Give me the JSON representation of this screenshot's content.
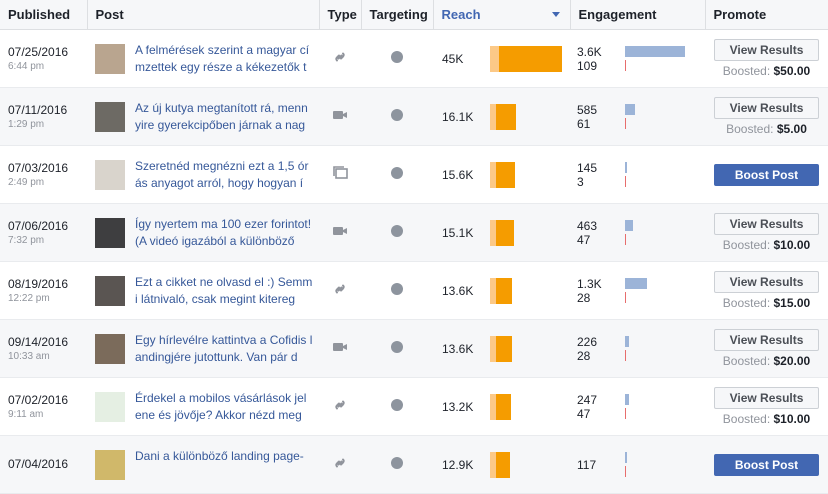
{
  "headers": {
    "published": "Published",
    "post": "Post",
    "type": "Type",
    "targeting": "Targeting",
    "reach": "Reach",
    "engagement": "Engagement",
    "promote": "Promote"
  },
  "rows": [
    {
      "date": "07/25/2016",
      "time": "6:44 pm",
      "text": "A felmérések szerint a magyar címzettek egy része a kékezetők többsége nem tudja",
      "type": "link-icon",
      "reach": "45K",
      "reach_fraction": 1.0,
      "eng_top": "3.6K",
      "eng_bottom": "109",
      "eng_fraction": 1.0,
      "promote_label": "View Results",
      "boosted_label": "Boosted:",
      "boosted_amount": "$50.00"
    },
    {
      "date": "07/11/2016",
      "time": "1:29 pm",
      "text": "Az új kutya megtanított rá, mennyire gyerekcipőben járnak a nag",
      "type": "video-icon",
      "reach": "16.1K",
      "reach_fraction": 0.36,
      "eng_top": "585",
      "eng_bottom": "61",
      "eng_fraction": 0.16,
      "promote_label": "View Results",
      "boosted_label": "Boosted:",
      "boosted_amount": "$5.00"
    },
    {
      "date": "07/03/2016",
      "time": "2:49 pm",
      "text": "Szeretnéd megnézni ezt a 1,5 órás anyagot arról, hogy hogyan í",
      "type": "album-icon",
      "reach": "15.6K",
      "reach_fraction": 0.35,
      "eng_top": "145",
      "eng_bottom": "3",
      "eng_fraction": 0.04,
      "promote_label": "Boost Post",
      "boosted_label": "",
      "boosted_amount": ""
    },
    {
      "date": "07/06/2016",
      "time": "7:32 pm",
      "text": "Így nyertem ma 100 ezer forintot! (A videó igazából a különböző",
      "type": "video-icon",
      "reach": "15.1K",
      "reach_fraction": 0.34,
      "eng_top": "463",
      "eng_bottom": "47",
      "eng_fraction": 0.13,
      "promote_label": "View Results",
      "boosted_label": "Boosted:",
      "boosted_amount": "$10.00"
    },
    {
      "date": "08/19/2016",
      "time": "12:22 pm",
      "text": "Ezt a cikket ne olvasd el :) Semmi látnivaló, csak megint kitereg",
      "type": "link-icon",
      "reach": "13.6K",
      "reach_fraction": 0.3,
      "eng_top": "1.3K",
      "eng_bottom": "28",
      "eng_fraction": 0.36,
      "promote_label": "View Results",
      "boosted_label": "Boosted:",
      "boosted_amount": "$15.00"
    },
    {
      "date": "09/14/2016",
      "time": "10:33 am",
      "text": "Egy hírlevélre kattintva a Cofidis landingjére jutottunk. Van pár d",
      "type": "video-icon",
      "reach": "13.6K",
      "reach_fraction": 0.3,
      "eng_top": "226",
      "eng_bottom": "28",
      "eng_fraction": 0.06,
      "promote_label": "View Results",
      "boosted_label": "Boosted:",
      "boosted_amount": "$20.00"
    },
    {
      "date": "07/02/2016",
      "time": "9:11 am",
      "text": "Érdekel a mobilos vásárlások jelene és jövője? Akkor nézd meg",
      "type": "link-icon",
      "reach": "13.2K",
      "reach_fraction": 0.29,
      "eng_top": "247",
      "eng_bottom": "47",
      "eng_fraction": 0.07,
      "promote_label": "View Results",
      "boosted_label": "Boosted:",
      "boosted_amount": "$10.00"
    },
    {
      "date": "07/04/2016",
      "time": "",
      "text": "Dani a különböző landing page-",
      "type": "link-icon",
      "reach": "12.9K",
      "reach_fraction": 0.28,
      "eng_top": "117",
      "eng_bottom": "",
      "eng_fraction": 0.03,
      "promote_label": "Boost Post",
      "boosted_label": "",
      "boosted_amount": ""
    }
  ]
}
